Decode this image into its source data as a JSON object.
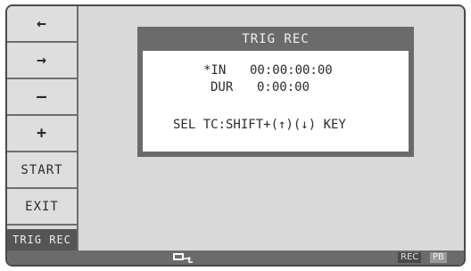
{
  "sidebar": {
    "left_label": "←",
    "right_label": "→",
    "minus_label": "–",
    "plus_label": "+",
    "start_label": "START",
    "exit_label": "EXIT",
    "active_label": "TRIG REC"
  },
  "dialog": {
    "title": "TRIG REC",
    "in_label": "*IN",
    "in_value": "00:00:00:00",
    "dur_label": "DUR",
    "dur_value": "0:00:00",
    "hint": "SEL TC:SHIFT+(↑)(↓) KEY"
  },
  "status": {
    "icon": "tape-icon",
    "rec_label": "REC",
    "pb_label": "PB"
  }
}
